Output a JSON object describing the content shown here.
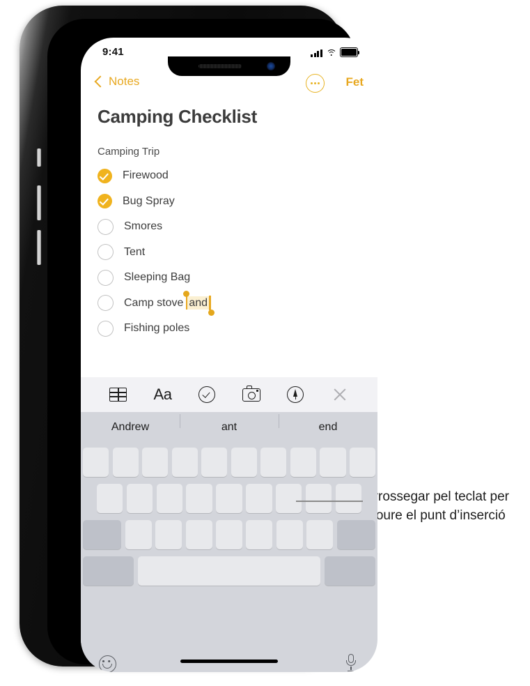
{
  "status_bar": {
    "time": "9:41",
    "signal_icon": "cellular-signal-icon",
    "wifi_icon": "wifi-icon",
    "battery_icon": "battery-full-icon"
  },
  "nav_bar": {
    "back_label": "Notes",
    "back_icon": "chevron-left-icon",
    "more_icon": "more-ellipsis-circle-icon",
    "done_label": "Fet"
  },
  "note": {
    "title": "Camping Checklist",
    "section_header": "Camping Trip",
    "items": [
      {
        "label": "Firewood",
        "checked": true
      },
      {
        "label": "Bug Spray",
        "checked": true
      },
      {
        "label": "Smores",
        "checked": false
      },
      {
        "label": "Tent",
        "checked": false
      },
      {
        "label": "Sleeping Bag",
        "checked": false
      },
      {
        "label": "Camp stove",
        "checked": false,
        "selected_text": "and"
      },
      {
        "label": "Fishing poles",
        "checked": false
      }
    ]
  },
  "toolbar": {
    "table_label": "table-icon",
    "format_label": "Aa",
    "checklist_label": "checklist-icon",
    "camera_label": "camera-icon",
    "markup_label": "markup-pen-icon",
    "close_label": "close-icon"
  },
  "predictive_bar": {
    "suggestions": [
      "Andrew",
      "ant",
      "end"
    ]
  },
  "keyboard": {
    "emoji_icon": "emoji-smiley-icon",
    "mic_icon": "microphone-icon",
    "row1_keys": 10,
    "row2_keys": 9,
    "row3_keys": 7
  },
  "callout": {
    "text": "Arrossegar pel teclat per moure el punt d’inserció"
  },
  "colors": {
    "accent": "#E8A820",
    "checkbox_checked": "#F0B31E",
    "selection_highlight": "#FBF0D2",
    "keyboard_bg": "#D3D5DB",
    "toolbar_bg": "#F2F2F5",
    "key_bg": "#E8E9EC",
    "key_dark_bg": "#BEC1C9"
  }
}
